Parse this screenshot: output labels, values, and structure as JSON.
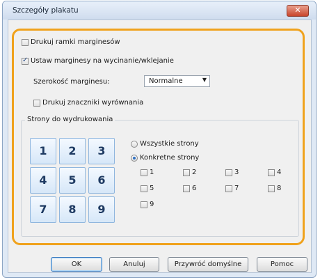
{
  "window": {
    "title": "Szczegóły plakatu",
    "close_icon": "close-icon"
  },
  "options": {
    "print_margin_frames": {
      "label": "Drukuj ramki marginesów",
      "checked": false
    },
    "set_cut_margins": {
      "label": "Ustaw marginesy na wycinanie/wklejanie",
      "checked": true
    },
    "margin_width_label": "Szerokość marginesu:",
    "margin_width_value": "Normalne",
    "print_alignment_marks": {
      "label": "Drukuj znaczniki wyrównania",
      "checked": false
    }
  },
  "pages_group": {
    "title": "Strony do wydrukowania",
    "grid": [
      "1",
      "2",
      "3",
      "4",
      "5",
      "6",
      "7",
      "8",
      "9"
    ],
    "radio_all": "Wszystkie strony",
    "radio_specific": "Konkretne strony",
    "selected_radio": "specific",
    "page_checkboxes": [
      "1",
      "2",
      "3",
      "4",
      "5",
      "6",
      "7",
      "8",
      "9"
    ]
  },
  "buttons": {
    "ok": "OK",
    "cancel": "Anuluj",
    "restore_defaults": "Przywróć domyślne",
    "help": "Pomoc"
  },
  "colors": {
    "highlight": "#f0a21c",
    "accent": "#2f6fc0"
  }
}
